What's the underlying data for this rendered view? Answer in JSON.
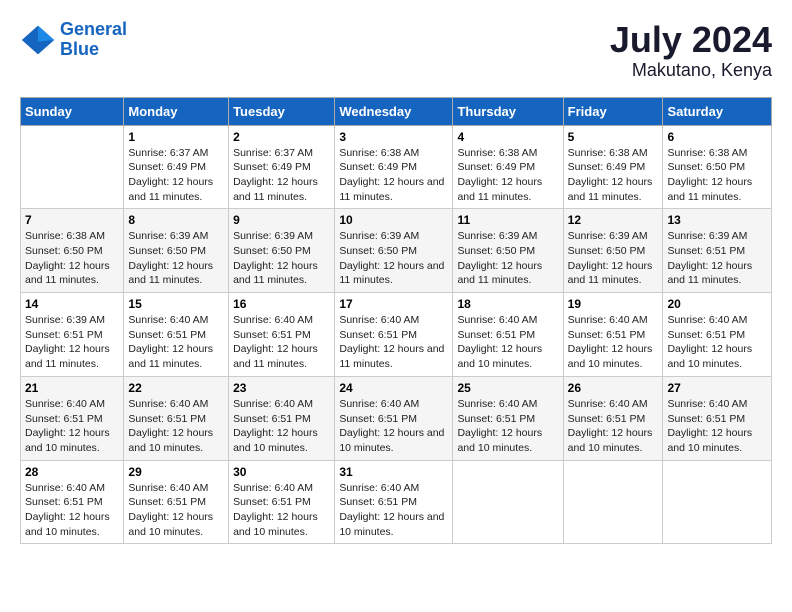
{
  "logo": {
    "line1": "General",
    "line2": "Blue"
  },
  "title": "July 2024",
  "subtitle": "Makutano, Kenya",
  "days_of_week": [
    "Sunday",
    "Monday",
    "Tuesday",
    "Wednesday",
    "Thursday",
    "Friday",
    "Saturday"
  ],
  "weeks": [
    [
      {
        "num": "",
        "sunrise": "",
        "sunset": "",
        "daylight": ""
      },
      {
        "num": "1",
        "sunrise": "Sunrise: 6:37 AM",
        "sunset": "Sunset: 6:49 PM",
        "daylight": "Daylight: 12 hours and 11 minutes."
      },
      {
        "num": "2",
        "sunrise": "Sunrise: 6:37 AM",
        "sunset": "Sunset: 6:49 PM",
        "daylight": "Daylight: 12 hours and 11 minutes."
      },
      {
        "num": "3",
        "sunrise": "Sunrise: 6:38 AM",
        "sunset": "Sunset: 6:49 PM",
        "daylight": "Daylight: 12 hours and 11 minutes."
      },
      {
        "num": "4",
        "sunrise": "Sunrise: 6:38 AM",
        "sunset": "Sunset: 6:49 PM",
        "daylight": "Daylight: 12 hours and 11 minutes."
      },
      {
        "num": "5",
        "sunrise": "Sunrise: 6:38 AM",
        "sunset": "Sunset: 6:49 PM",
        "daylight": "Daylight: 12 hours and 11 minutes."
      },
      {
        "num": "6",
        "sunrise": "Sunrise: 6:38 AM",
        "sunset": "Sunset: 6:50 PM",
        "daylight": "Daylight: 12 hours and 11 minutes."
      }
    ],
    [
      {
        "num": "7",
        "sunrise": "Sunrise: 6:38 AM",
        "sunset": "Sunset: 6:50 PM",
        "daylight": "Daylight: 12 hours and 11 minutes."
      },
      {
        "num": "8",
        "sunrise": "Sunrise: 6:39 AM",
        "sunset": "Sunset: 6:50 PM",
        "daylight": "Daylight: 12 hours and 11 minutes."
      },
      {
        "num": "9",
        "sunrise": "Sunrise: 6:39 AM",
        "sunset": "Sunset: 6:50 PM",
        "daylight": "Daylight: 12 hours and 11 minutes."
      },
      {
        "num": "10",
        "sunrise": "Sunrise: 6:39 AM",
        "sunset": "Sunset: 6:50 PM",
        "daylight": "Daylight: 12 hours and 11 minutes."
      },
      {
        "num": "11",
        "sunrise": "Sunrise: 6:39 AM",
        "sunset": "Sunset: 6:50 PM",
        "daylight": "Daylight: 12 hours and 11 minutes."
      },
      {
        "num": "12",
        "sunrise": "Sunrise: 6:39 AM",
        "sunset": "Sunset: 6:50 PM",
        "daylight": "Daylight: 12 hours and 11 minutes."
      },
      {
        "num": "13",
        "sunrise": "Sunrise: 6:39 AM",
        "sunset": "Sunset: 6:51 PM",
        "daylight": "Daylight: 12 hours and 11 minutes."
      }
    ],
    [
      {
        "num": "14",
        "sunrise": "Sunrise: 6:39 AM",
        "sunset": "Sunset: 6:51 PM",
        "daylight": "Daylight: 12 hours and 11 minutes."
      },
      {
        "num": "15",
        "sunrise": "Sunrise: 6:40 AM",
        "sunset": "Sunset: 6:51 PM",
        "daylight": "Daylight: 12 hours and 11 minutes."
      },
      {
        "num": "16",
        "sunrise": "Sunrise: 6:40 AM",
        "sunset": "Sunset: 6:51 PM",
        "daylight": "Daylight: 12 hours and 11 minutes."
      },
      {
        "num": "17",
        "sunrise": "Sunrise: 6:40 AM",
        "sunset": "Sunset: 6:51 PM",
        "daylight": "Daylight: 12 hours and 11 minutes."
      },
      {
        "num": "18",
        "sunrise": "Sunrise: 6:40 AM",
        "sunset": "Sunset: 6:51 PM",
        "daylight": "Daylight: 12 hours and 10 minutes."
      },
      {
        "num": "19",
        "sunrise": "Sunrise: 6:40 AM",
        "sunset": "Sunset: 6:51 PM",
        "daylight": "Daylight: 12 hours and 10 minutes."
      },
      {
        "num": "20",
        "sunrise": "Sunrise: 6:40 AM",
        "sunset": "Sunset: 6:51 PM",
        "daylight": "Daylight: 12 hours and 10 minutes."
      }
    ],
    [
      {
        "num": "21",
        "sunrise": "Sunrise: 6:40 AM",
        "sunset": "Sunset: 6:51 PM",
        "daylight": "Daylight: 12 hours and 10 minutes."
      },
      {
        "num": "22",
        "sunrise": "Sunrise: 6:40 AM",
        "sunset": "Sunset: 6:51 PM",
        "daylight": "Daylight: 12 hours and 10 minutes."
      },
      {
        "num": "23",
        "sunrise": "Sunrise: 6:40 AM",
        "sunset": "Sunset: 6:51 PM",
        "daylight": "Daylight: 12 hours and 10 minutes."
      },
      {
        "num": "24",
        "sunrise": "Sunrise: 6:40 AM",
        "sunset": "Sunset: 6:51 PM",
        "daylight": "Daylight: 12 hours and 10 minutes."
      },
      {
        "num": "25",
        "sunrise": "Sunrise: 6:40 AM",
        "sunset": "Sunset: 6:51 PM",
        "daylight": "Daylight: 12 hours and 10 minutes."
      },
      {
        "num": "26",
        "sunrise": "Sunrise: 6:40 AM",
        "sunset": "Sunset: 6:51 PM",
        "daylight": "Daylight: 12 hours and 10 minutes."
      },
      {
        "num": "27",
        "sunrise": "Sunrise: 6:40 AM",
        "sunset": "Sunset: 6:51 PM",
        "daylight": "Daylight: 12 hours and 10 minutes."
      }
    ],
    [
      {
        "num": "28",
        "sunrise": "Sunrise: 6:40 AM",
        "sunset": "Sunset: 6:51 PM",
        "daylight": "Daylight: 12 hours and 10 minutes."
      },
      {
        "num": "29",
        "sunrise": "Sunrise: 6:40 AM",
        "sunset": "Sunset: 6:51 PM",
        "daylight": "Daylight: 12 hours and 10 minutes."
      },
      {
        "num": "30",
        "sunrise": "Sunrise: 6:40 AM",
        "sunset": "Sunset: 6:51 PM",
        "daylight": "Daylight: 12 hours and 10 minutes."
      },
      {
        "num": "31",
        "sunrise": "Sunrise: 6:40 AM",
        "sunset": "Sunset: 6:51 PM",
        "daylight": "Daylight: 12 hours and 10 minutes."
      },
      {
        "num": "",
        "sunrise": "",
        "sunset": "",
        "daylight": ""
      },
      {
        "num": "",
        "sunrise": "",
        "sunset": "",
        "daylight": ""
      },
      {
        "num": "",
        "sunrise": "",
        "sunset": "",
        "daylight": ""
      }
    ]
  ]
}
